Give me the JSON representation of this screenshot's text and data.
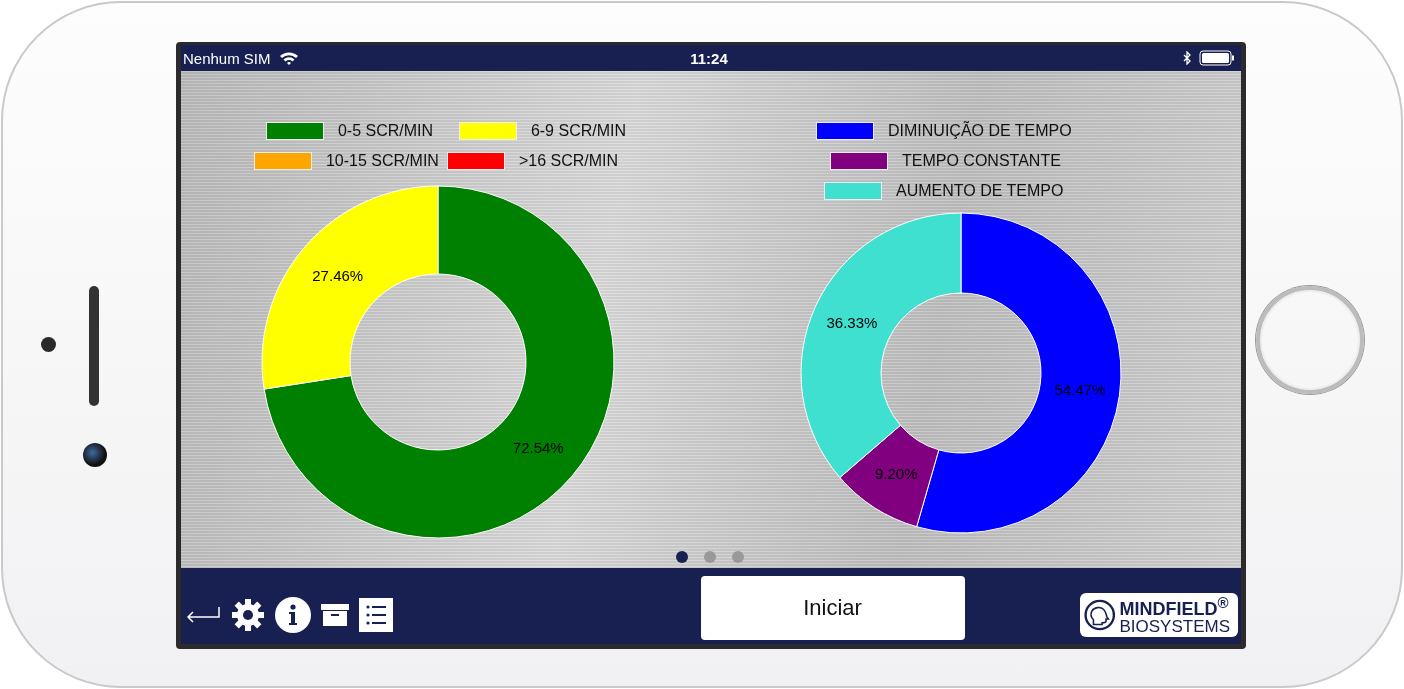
{
  "status_bar": {
    "carrier": "Nenhum SIM",
    "time": "11:24"
  },
  "charts": [
    {
      "legend": [
        {
          "color": "#008000"
        },
        {
          "color": "#ffff00"
        },
        {
          "color": "#ffa500"
        },
        {
          "color": "#ff0000"
        }
      ],
      "chart_data": {
        "type": "donut",
        "categories": [
          "0-5 SCR/MIN",
          "6-9 SCR/MIN",
          "10-15 SCR/MIN",
          ">16 SCR/MIN"
        ],
        "values": [
          72.54,
          27.46,
          0,
          0
        ],
        "value_labels": [
          "72.54%",
          "27.46%",
          null,
          null
        ]
      }
    },
    {
      "legend": [
        {
          "color": "#0000ff"
        },
        {
          "color": "#800080"
        },
        {
          "color": "#40e0d0"
        }
      ],
      "chart_data": {
        "type": "donut",
        "categories": [
          "DIMINUIÇÃO DE TEMPO",
          "TEMPO CONSTANTE",
          "AUMENTO DE TEMPO"
        ],
        "values": [
          54.47,
          9.2,
          36.33
        ],
        "value_labels": [
          "54.47%",
          "9.20%",
          "36.33%"
        ]
      }
    }
  ],
  "page_dots": [
    {
      "selected": true
    },
    {
      "selected": false
    },
    {
      "selected": false
    }
  ],
  "toolbar": {
    "start_button": "Iniciar",
    "logo": [
      "MINDFIELD$^{®}$",
      "BIOSYSTEMS"
    ]
  }
}
